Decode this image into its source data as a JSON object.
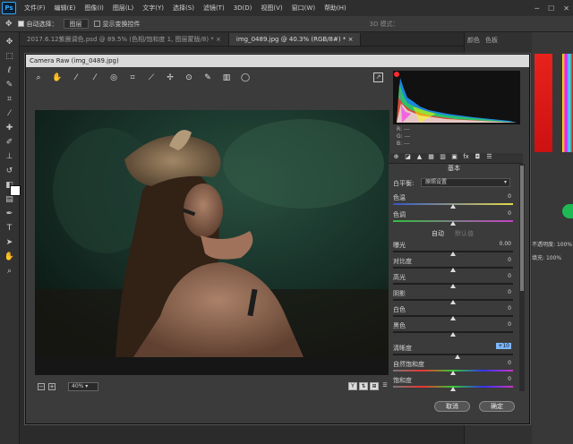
{
  "app": {
    "logo": "Ps",
    "menus": [
      "文件(F)",
      "编辑(E)",
      "图像(I)",
      "图层(L)",
      "文字(Y)",
      "选择(S)",
      "滤镜(T)",
      "3D(D)",
      "视图(V)",
      "窗口(W)",
      "帮助(H)"
    ]
  },
  "options": {
    "auto_select_label": "自动选择：",
    "auto_select_value": "图层",
    "show_transform_label": "显示变换控件",
    "mode_3d": "3D 模式："
  },
  "tabs": [
    {
      "label": "2017.6.12紫晨调色.psd @ 89.5% (色相/饱和度 1, 图层蒙版/8) *"
    },
    {
      "label": "img_0489.jpg @ 40.3% (RGB/8#) *"
    }
  ],
  "panel_tabs": [
    "颜色",
    "色板"
  ],
  "right_fields": {
    "opacity_label": "不透明度:",
    "opacity_value": "100%",
    "fill_label": "填充:",
    "fill_value": "100%"
  },
  "camera_raw": {
    "title": "Camera Raw (img_0489.jpg)",
    "zoom": "40%",
    "rgb": {
      "r": "R: ---",
      "g": "G: ---",
      "b": "B: ---"
    },
    "panel_title": "基本",
    "wb_label": "白平衡:",
    "wb_value": "原照设置",
    "temp": {
      "label": "色温",
      "value": "0"
    },
    "tint": {
      "label": "色调",
      "value": "0"
    },
    "auto_label": "自动",
    "default_label": "默认值",
    "sliders": [
      {
        "label": "曝光",
        "value": "0.00"
      },
      {
        "label": "对比度",
        "value": "0"
      },
      {
        "label": "高光",
        "value": "0"
      },
      {
        "label": "阴影",
        "value": "0"
      },
      {
        "label": "白色",
        "value": "0"
      },
      {
        "label": "黑色",
        "value": "0"
      }
    ],
    "clarity": {
      "label": "清晰度",
      "value": "+10"
    },
    "vibrance": {
      "label": "自然饱和度",
      "value": "0"
    },
    "saturation": {
      "label": "饱和度",
      "value": "0"
    },
    "cancel": "取消",
    "ok": "确定"
  },
  "colors": {
    "accent": "#31a8ff",
    "dialog_bg": "#3b3b3b",
    "app_bg": "#2b2b2b"
  }
}
